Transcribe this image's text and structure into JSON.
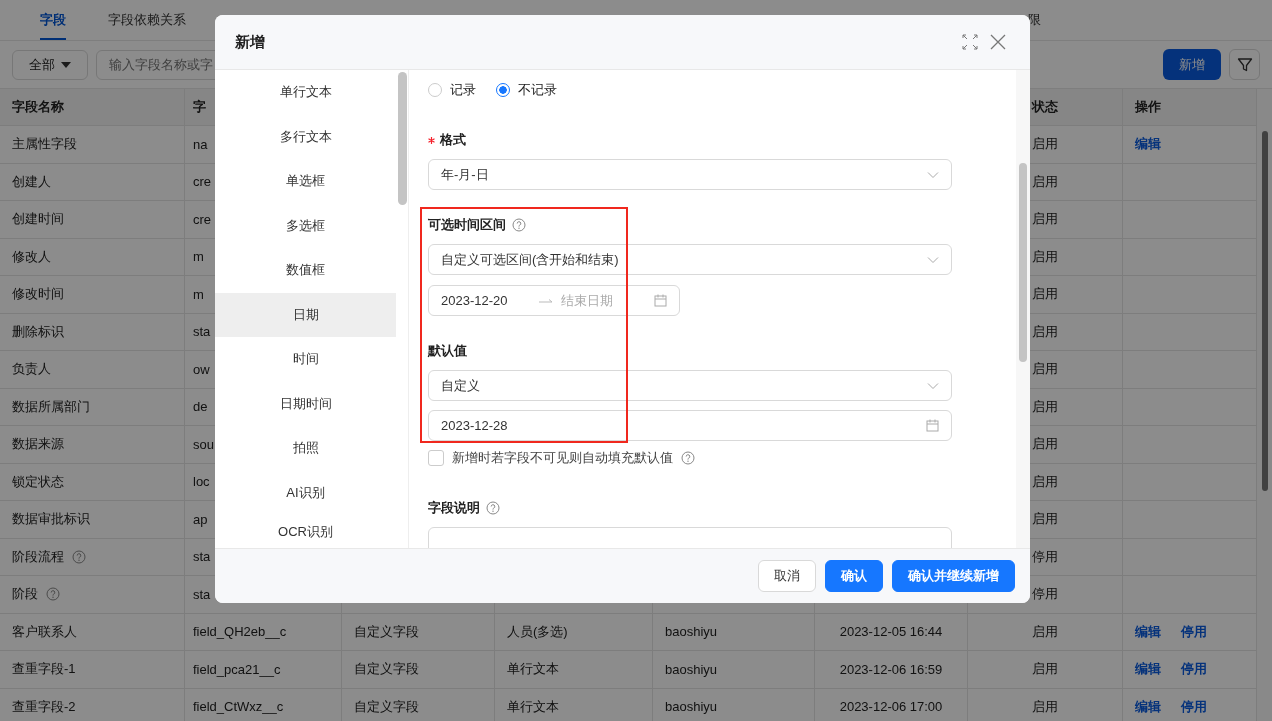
{
  "tabs": [
    {
      "label": "字段",
      "selected": true
    },
    {
      "label": "字段依赖关系",
      "selected": false
    }
  ],
  "tabs_right": [
    {
      "label": "限",
      "selected": false
    }
  ],
  "toolbar": {
    "filter": "全部",
    "search": {
      "placeholder": "输入字段名称或字"
    },
    "add_button": "新增"
  },
  "table": {
    "columns": [
      "字段名称",
      "字",
      "",
      "",
      "",
      "",
      "状态",
      "操作"
    ],
    "rows": [
      {
        "name": "主属性字段",
        "code": "na",
        "status": "启用",
        "actions": [
          "编辑"
        ]
      },
      {
        "name": "创建人",
        "code": "cre",
        "status": "启用",
        "actions": []
      },
      {
        "name": "创建时间",
        "code": "cre",
        "status": "启用",
        "actions": []
      },
      {
        "name": "修改人",
        "code": "m",
        "status": "启用",
        "actions": []
      },
      {
        "name": "修改时间",
        "code": "m",
        "status": "启用",
        "actions": []
      },
      {
        "name": "删除标识",
        "code": "sta",
        "status": "启用",
        "actions": []
      },
      {
        "name": "负责人",
        "code": "ow",
        "status": "启用",
        "actions": []
      },
      {
        "name": "数据所属部门",
        "code": "de",
        "status": "启用",
        "actions": []
      },
      {
        "name": "数据来源",
        "code": "sou",
        "status": "启用",
        "actions": []
      },
      {
        "name": "锁定状态",
        "code": "loc",
        "status": "启用",
        "actions": []
      },
      {
        "name": "数据审批标识",
        "code": "ap",
        "status": "启用",
        "actions": []
      },
      {
        "name": "阶段流程",
        "help": true,
        "code": "sta",
        "status": "停用",
        "actions": []
      },
      {
        "name": "阶段",
        "help": true,
        "code": "sta",
        "status": "停用",
        "actions": []
      },
      {
        "name": "客户联系人",
        "code": "field_QH2eb__c",
        "source": "自定义字段",
        "type": "人员(多选)",
        "creator": "baoshiyu",
        "created": "2023-12-05 16:44",
        "status": "启用",
        "actions": [
          "编辑",
          "停用"
        ]
      },
      {
        "name": "查重字段-1",
        "code": "field_pca21__c",
        "source": "自定义字段",
        "type": "单行文本",
        "creator": "baoshiyu",
        "created": "2023-12-06 16:59",
        "status": "启用",
        "actions": [
          "编辑",
          "停用"
        ]
      },
      {
        "name": "查重字段-2",
        "code": "field_CtWxz__c",
        "source": "自定义字段",
        "type": "单行文本",
        "creator": "baoshiyu",
        "created": "2023-12-06 17:00",
        "status": "启用",
        "actions": [
          "编辑",
          "停用"
        ]
      }
    ]
  },
  "dialog": {
    "title": "新增",
    "field_types": [
      {
        "label": "单行文本",
        "selected": false
      },
      {
        "label": "多行文本",
        "selected": false
      },
      {
        "label": "单选框",
        "selected": false
      },
      {
        "label": "多选框",
        "selected": false
      },
      {
        "label": "数值框",
        "selected": false
      },
      {
        "label": "日期",
        "selected": true
      },
      {
        "label": "时间",
        "selected": false
      },
      {
        "label": "日期时间",
        "selected": false
      },
      {
        "label": "拍照",
        "selected": false
      },
      {
        "label": "AI识别",
        "selected": false
      },
      {
        "label": "OCR识别",
        "selected": false
      }
    ],
    "form": [
      {
        "kind": "radios",
        "options": [
          {
            "label": "记录",
            "selected": false
          },
          {
            "label": "不记录",
            "selected": true
          }
        ]
      },
      {
        "kind": "label",
        "text": "格式",
        "required": true
      },
      {
        "kind": "select",
        "value": "年-月-日"
      },
      {
        "kind": "label",
        "text": "可选时间区间",
        "help": true
      },
      {
        "kind": "select",
        "value": "自定义可选区间(含开始和结束)"
      },
      {
        "kind": "date_range",
        "value": "2023-12-20",
        "placeholder": "结束日期"
      },
      {
        "kind": "label",
        "text": "默认值"
      },
      {
        "kind": "select",
        "value": "自定义"
      },
      {
        "kind": "date",
        "value": "2023-12-28"
      },
      {
        "kind": "checkbox",
        "label": "新增时若字段不可见则自动填充默认值",
        "checked": false,
        "help": true
      },
      {
        "kind": "label",
        "text": "字段说明",
        "help": true
      },
      {
        "kind": "textarea"
      }
    ],
    "buttons": [
      {
        "label": "取消",
        "kind": "default"
      },
      {
        "label": "确认",
        "kind": "primary"
      },
      {
        "label": "确认并继续新增",
        "kind": "primary"
      }
    ]
  }
}
